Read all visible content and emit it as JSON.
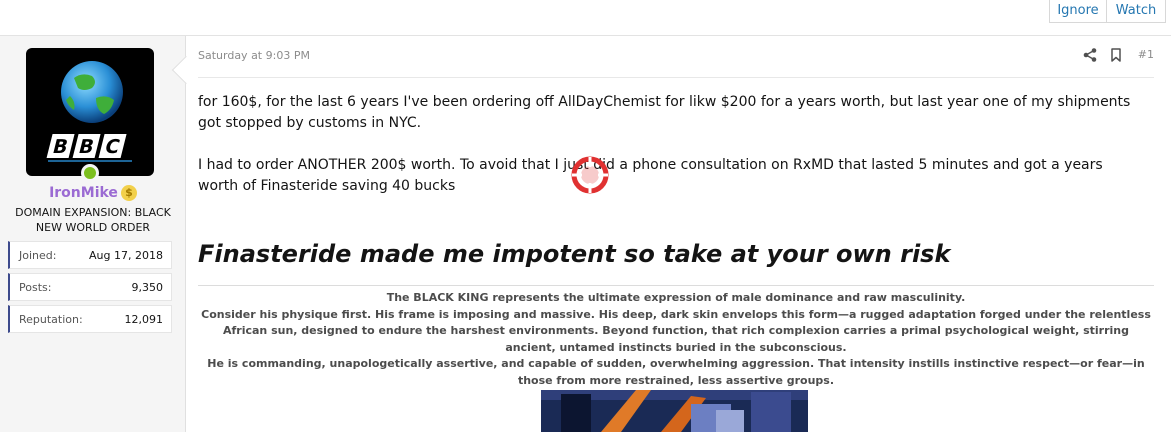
{
  "thread_actions": {
    "ignore_label": "Ignore",
    "watch_label": "Watch"
  },
  "user": {
    "avatar": "bbc-globe-avatar",
    "name": "IronMike",
    "badge_icon": "dollar-coin-icon",
    "title": "DOMAIN EXPANSION: BLACK NEW WORLD ORDER",
    "online": true,
    "stats": [
      {
        "label": "Joined:",
        "value": "Aug 17, 2018"
      },
      {
        "label": "Posts:",
        "value": "9,350"
      },
      {
        "label": "Reputation:",
        "value": "12,091"
      }
    ]
  },
  "post": {
    "timestamp": "Saturday at 9:03 PM",
    "share_icon": "share-icon",
    "bookmark_icon": "bookmark-icon",
    "number": "#1",
    "paragraphs": [
      "for 160$, for the last 6 years I've been ordering off AllDayChemist for likw $200 for a years worth, but last year one of my shipments got stopped by customs in NYC.",
      "I had to order ANOTHER 200$ worth. To avoid that I just did a phone consultation on RxMD that lasted 5 minutes and got a years worth of Finasteride saving 40 bucks"
    ],
    "signature": {
      "headline": "Finasteride made me impotent so take at your own risk",
      "lines": [
        "The BLACK KING represents the ultimate expression of male dominance and raw masculinity.",
        "Consider his physique first. His frame is imposing and massive. His deep, dark skin envelops this form—a rugged adaptation forged under the relentless African sun, designed to endure the harshest environments. Beyond function, that rich complexion carries a primal psychological weight, stirring ancient, untamed instincts buried in the subconscious.",
        "He is commanding, unapologetically assertive, and capable of sudden, overwhelming aggression. That intensity instills instinctive respect—or fear—in those from more restrained, less assertive groups."
      ]
    }
  },
  "colors": {
    "link": "#2577b1",
    "username": "#9b6bd3",
    "online": "#7cbf1e",
    "stat_accent": "#3d4a8c",
    "cursor": "#e03131"
  }
}
